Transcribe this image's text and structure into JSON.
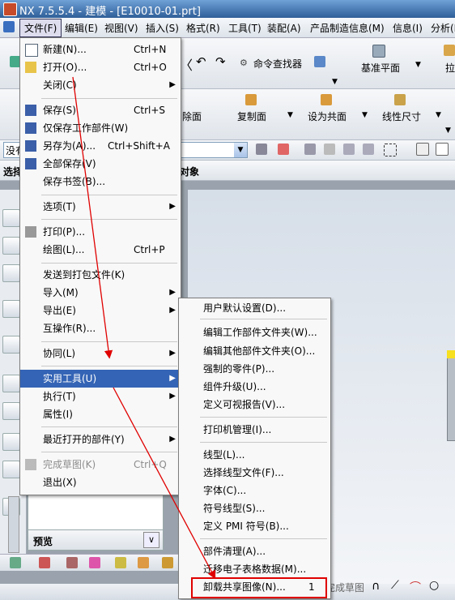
{
  "window": {
    "title": "NX 7.5.5.4 - 建模 - [E10010-01.prt]"
  },
  "menubar": {
    "items": [
      "文件(F)",
      "编辑(E)",
      "视图(V)",
      "插入(S)",
      "格式(R)",
      "工具(T)",
      "装配(A)",
      "产品制造信息(M)",
      "信息(I)",
      "分析(L)"
    ]
  },
  "toolbar1": {
    "command_finder": "命令查找器",
    "datum_plane": "基准平面",
    "partial_label": "拉"
  },
  "toolbar2": {
    "delete_face": "除面",
    "copy_face": "复制面",
    "make_coplanar": "设为共面",
    "linear_dim": "线性尺寸"
  },
  "selection_bar": {
    "filter_value": "没有",
    "left_label": "选择",
    "right_label": "对象"
  },
  "file_menu": {
    "items": [
      {
        "label": "新建(N)...",
        "shortcut": "Ctrl+N",
        "icon": "new-file-icon"
      },
      {
        "label": "打开(O)...",
        "shortcut": "Ctrl+O",
        "icon": "open-folder-icon"
      },
      {
        "label": "关闭(C)",
        "submenu": true
      },
      {
        "label": "保存(S)",
        "shortcut": "Ctrl+S",
        "icon": "save-icon"
      },
      {
        "label": "仅保存工作部件(W)",
        "icon": "save-work-part-icon"
      },
      {
        "label": "另存为(A)...",
        "shortcut": "Ctrl+Shift+A",
        "icon": "save-as-icon"
      },
      {
        "label": "全部保存(V)",
        "icon": "save-all-icon"
      },
      {
        "label": "保存书签(B)..."
      },
      {
        "label": "选项(T)",
        "submenu": true
      },
      {
        "label": "打印(P)...",
        "icon": "print-icon"
      },
      {
        "label": "绘图(L)...",
        "shortcut": "Ctrl+P"
      },
      {
        "label": "发送到打包文件(K)"
      },
      {
        "label": "导入(M)",
        "submenu": true
      },
      {
        "label": "导出(E)",
        "submenu": true
      },
      {
        "label": "互操作(R)..."
      },
      {
        "label": "协同(L)",
        "submenu": true
      },
      {
        "label": "实用工具(U)",
        "submenu": true,
        "highlighted": true
      },
      {
        "label": "执行(T)",
        "submenu": true
      },
      {
        "label": "属性(I)"
      },
      {
        "label": "最近打开的部件(Y)",
        "submenu": true
      },
      {
        "label": "完成草图(K)",
        "shortcut": "Ctrl+Q",
        "disabled": true,
        "icon": "finish-sketch-icon"
      },
      {
        "label": "退出(X)"
      }
    ]
  },
  "utilities_submenu": {
    "items": [
      {
        "label": "用户默认设置(D)..."
      },
      {
        "label": "编辑工作部件文件夹(W)..."
      },
      {
        "label": "编辑其他部件文件夹(O)..."
      },
      {
        "label": "强制的零件(P)..."
      },
      {
        "label": "组件升级(U)..."
      },
      {
        "label": "定义可视报告(V)..."
      },
      {
        "label": "打印机管理(I)..."
      },
      {
        "label": "线型(L)..."
      },
      {
        "label": "选择线型文件(F)..."
      },
      {
        "label": "字体(C)..."
      },
      {
        "label": "符号线型(S)..."
      },
      {
        "label": "定义 PMI 符号(B)..."
      },
      {
        "label": "部件清理(A)..."
      },
      {
        "label": "迁移电子表格数据(M)..."
      },
      {
        "label": "卸载共享图像(N)..."
      }
    ],
    "annotation_number": "1"
  },
  "side_panel": {
    "preview_label": "预览"
  },
  "statusbar": {
    "finish_sketch_partial": "完成草图"
  },
  "colors": {
    "highlight": "#3464b5",
    "annotation": "#e00000"
  }
}
